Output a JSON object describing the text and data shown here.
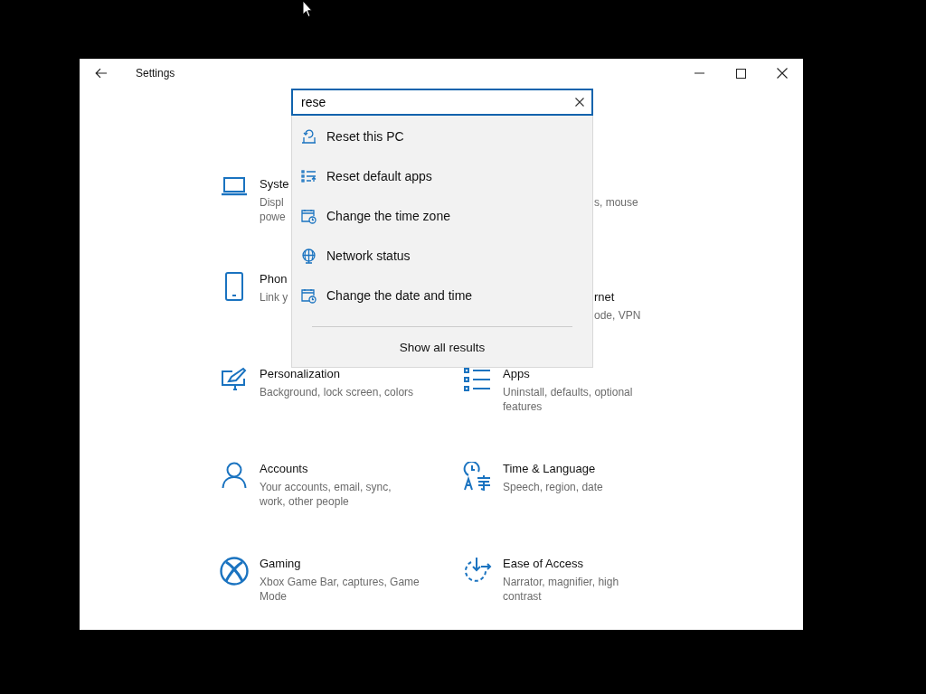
{
  "window": {
    "title": "Settings"
  },
  "search": {
    "value": "rese"
  },
  "suggestions": [
    {
      "label": "Reset this PC",
      "kind": "reset"
    },
    {
      "label": "Reset default apps",
      "kind": "defaults"
    },
    {
      "label": "Change the time zone",
      "kind": "calendar"
    },
    {
      "label": "Network status",
      "kind": "network"
    },
    {
      "label": "Change the date and time",
      "kind": "calendar"
    }
  ],
  "show_all": "Show all results",
  "categories": [
    {
      "title": "Syste",
      "lines": [
        "Displ",
        "powe"
      ],
      "kind": "system"
    },
    {
      "lines": [
        "s, mouse"
      ],
      "kind": "cut"
    },
    {
      "title": "Phon",
      "lines": [
        "Link y"
      ],
      "kind": "phone"
    },
    {
      "title": "rnet",
      "lines": [
        "ode, VPN"
      ],
      "kind": "cut"
    },
    {
      "title": "Personalization",
      "lines": [
        "Background, lock screen, colors"
      ],
      "kind": "personalization"
    },
    {
      "title": "Apps",
      "lines": [
        "Uninstall, defaults, optional",
        "features"
      ],
      "kind": "apps"
    },
    {
      "title": "Accounts",
      "lines": [
        "Your accounts, email, sync,",
        "work, other people"
      ],
      "kind": "accounts"
    },
    {
      "title": "Time & Language",
      "lines": [
        "Speech, region, date"
      ],
      "kind": "time"
    },
    {
      "title": "Gaming",
      "lines": [
        "Xbox Game Bar, captures, Game",
        "Mode"
      ],
      "kind": "gaming"
    },
    {
      "title": "Ease of Access",
      "lines": [
        "Narrator, magnifier, high",
        "contrast"
      ],
      "kind": "ease"
    }
  ]
}
